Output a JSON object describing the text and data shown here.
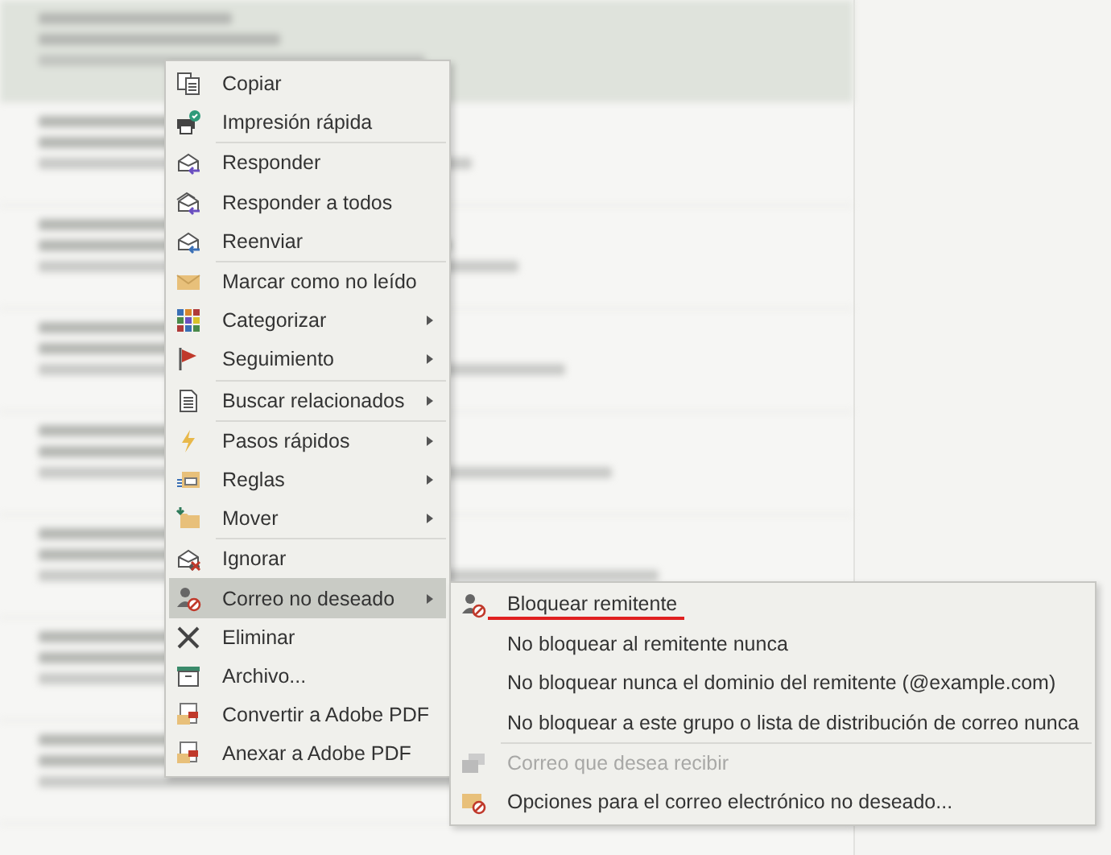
{
  "message_list": {
    "rows": [
      {
        "selected": true
      },
      {
        "selected": false
      },
      {
        "selected": false
      },
      {
        "selected": false
      },
      {
        "selected": false
      },
      {
        "selected": false
      },
      {
        "selected": false
      },
      {
        "selected": false
      }
    ]
  },
  "context_menu": {
    "groups": [
      {
        "items": [
          {
            "label": "Copiar",
            "submenu": false,
            "selected": false
          },
          {
            "label": "Impresión rápida",
            "submenu": false,
            "selected": false
          }
        ]
      },
      {
        "items": [
          {
            "label": "Responder",
            "submenu": false,
            "selected": false
          },
          {
            "label": "Responder a todos",
            "submenu": false,
            "selected": false
          },
          {
            "label": "Reenviar",
            "submenu": false,
            "selected": false
          }
        ]
      },
      {
        "items": [
          {
            "label": "Marcar como no leído",
            "submenu": false,
            "selected": false
          },
          {
            "label": "Categorizar",
            "submenu": true,
            "selected": false
          },
          {
            "label": "Seguimiento",
            "submenu": true,
            "selected": false
          }
        ]
      },
      {
        "items": [
          {
            "label": "Buscar relacionados",
            "submenu": true,
            "selected": false
          }
        ]
      },
      {
        "items": [
          {
            "label": "Pasos rápidos",
            "submenu": true,
            "selected": false
          },
          {
            "label": "Reglas",
            "submenu": true,
            "selected": false
          },
          {
            "label": "Mover",
            "submenu": true,
            "selected": false
          }
        ]
      },
      {
        "items": [
          {
            "label": "Ignorar",
            "submenu": false,
            "selected": false
          },
          {
            "label": "Correo no deseado",
            "submenu": true,
            "selected": true
          },
          {
            "label": "Eliminar",
            "submenu": false,
            "selected": false
          },
          {
            "label": "Archivo...",
            "submenu": false,
            "selected": false
          },
          {
            "label": "Convertir a Adobe PDF",
            "submenu": false,
            "selected": false
          },
          {
            "label": "Anexar a Adobe PDF",
            "submenu": false,
            "selected": false
          }
        ]
      }
    ]
  },
  "submenu": {
    "groups": [
      {
        "items": [
          {
            "label": "Bloquear remitente",
            "disabled": false,
            "underlined": true
          },
          {
            "label": "No bloquear al remitente nunca",
            "disabled": false,
            "underlined": false
          },
          {
            "label": "No bloquear nunca el dominio del remitente (@example.com)",
            "disabled": false,
            "underlined": false
          },
          {
            "label": "No bloquear a este grupo o lista de distribución de correo nunca",
            "disabled": false,
            "underlined": false
          }
        ]
      },
      {
        "items": [
          {
            "label": "Correo que desea recibir",
            "disabled": true,
            "underlined": false
          },
          {
            "label": "Opciones para el correo electrónico no deseado...",
            "disabled": false,
            "underlined": false
          }
        ]
      }
    ]
  }
}
